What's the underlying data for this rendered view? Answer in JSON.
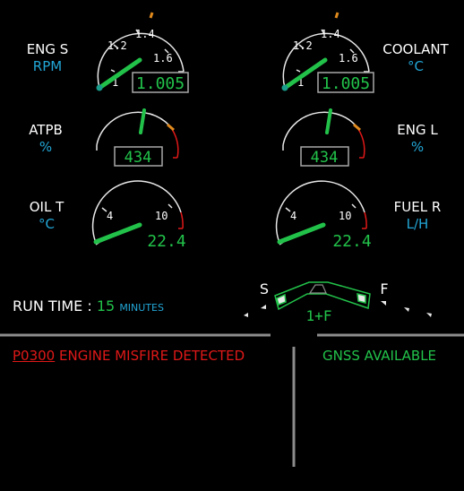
{
  "gauges": {
    "eng_s": {
      "title": "ENG S",
      "unit": "RPM",
      "ticks": [
        "1",
        "1.2",
        "1.4",
        "1.6"
      ],
      "readout": "1.005",
      "value": 1.005
    },
    "coolant": {
      "title": "COOLANT",
      "unit": "°C",
      "ticks": [
        "1",
        "1.2",
        "1.4",
        "1.6"
      ],
      "readout": "1.005",
      "value": 1.005
    },
    "atpb": {
      "title": "ATPB",
      "unit": "%",
      "readout": "434",
      "value": 434
    },
    "eng_l": {
      "title": "ENG L",
      "unit": "%",
      "readout": "434",
      "value": 434
    },
    "oil_t": {
      "title": "OIL T",
      "unit": "°C",
      "ticks": [
        "4",
        "10"
      ],
      "readout": "22.4",
      "value": 22.4
    },
    "fuel_r": {
      "title": "FUEL R",
      "unit": "L/H",
      "ticks": [
        "4",
        "10"
      ],
      "readout": "22.4",
      "value": 22.4
    }
  },
  "trim": {
    "left_label": "S",
    "right_label": "F",
    "readout": "1+F"
  },
  "run_time": {
    "label": "RUN TIME :",
    "value": "15",
    "unit": "MINUTES"
  },
  "alert": {
    "code": "P0300",
    "message": "ENGINE MISFIRE DETECTED"
  },
  "status": {
    "gnss": "GNSS AVAILABLE"
  },
  "colors": {
    "needle": "#22c24a",
    "accent": "#22a6d6",
    "caution": "#e08a1e",
    "warning": "#e01818",
    "arc": "#e8e8e8"
  }
}
